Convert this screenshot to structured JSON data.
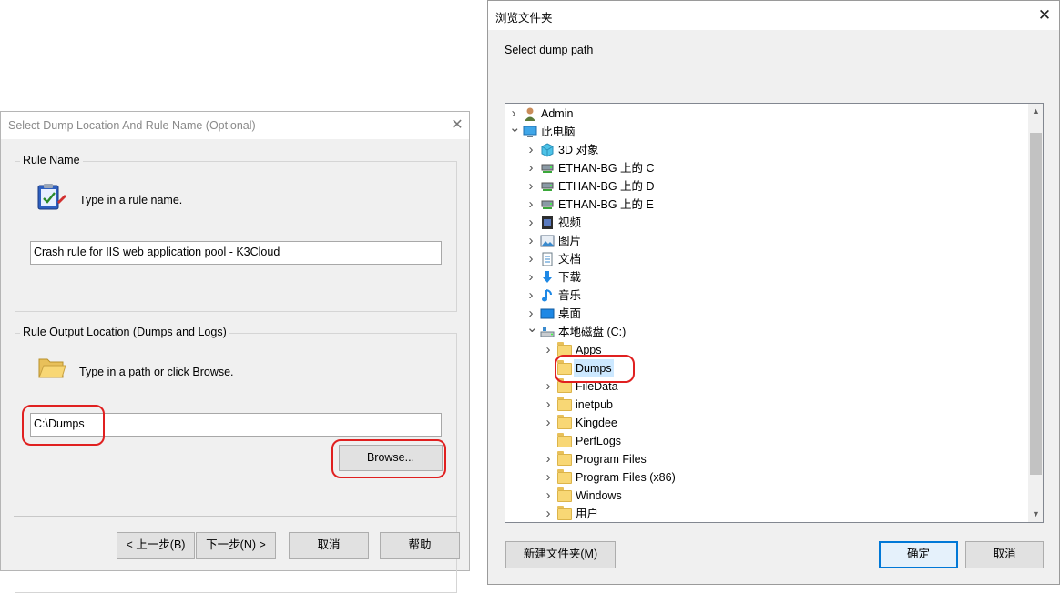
{
  "wizard": {
    "title": "Select Dump Location And Rule Name (Optional)",
    "rule_group_label": "Rule Name",
    "rule_prompt": "Type in a rule name.",
    "rule_name_value": "Crash rule for IIS web application pool - K3Cloud",
    "output_group_label": "Rule Output Location (Dumps and Logs)",
    "output_prompt": "Type in a path or click Browse.",
    "path_value": "C:\\Dumps",
    "browse_label": "Browse...",
    "back_label": "< 上一步(B)",
    "next_label": "下一步(N) >",
    "cancel_label": "取消",
    "help_label": "帮助"
  },
  "browser": {
    "title": "浏览文件夹",
    "prompt": "Select dump path",
    "tree": [
      {
        "label": "Admin",
        "icon": "user-icon",
        "expander": ">"
      },
      {
        "label": "此电脑",
        "icon": "computer-icon",
        "expander": "v"
      },
      {
        "label": "3D 对象",
        "icon": "3d-objects-icon",
        "expander": ">"
      },
      {
        "label": "ETHAN-BG 上的 C",
        "icon": "network-drive-icon",
        "expander": ">"
      },
      {
        "label": "ETHAN-BG 上的 D",
        "icon": "network-drive-icon",
        "expander": ">"
      },
      {
        "label": "ETHAN-BG 上的 E",
        "icon": "network-drive-icon",
        "expander": ">"
      },
      {
        "label": "视频",
        "icon": "videos-icon",
        "expander": ">"
      },
      {
        "label": "图片",
        "icon": "pictures-icon",
        "expander": ">"
      },
      {
        "label": "文档",
        "icon": "documents-icon",
        "expander": ">"
      },
      {
        "label": "下载",
        "icon": "downloads-icon",
        "expander": ">"
      },
      {
        "label": "音乐",
        "icon": "music-icon",
        "expander": ">"
      },
      {
        "label": "桌面",
        "icon": "desktop-icon",
        "expander": ">"
      },
      {
        "label": "本地磁盘 (C:)",
        "icon": "local-disk-icon",
        "expander": "v"
      },
      {
        "label": "Apps",
        "icon": "folder-icon",
        "expander": ">"
      },
      {
        "label": "Dumps",
        "icon": "folder-icon",
        "expander": "",
        "selected": true
      },
      {
        "label": "FileData",
        "icon": "folder-icon",
        "expander": ">"
      },
      {
        "label": "inetpub",
        "icon": "folder-icon",
        "expander": ">"
      },
      {
        "label": "Kingdee",
        "icon": "folder-icon",
        "expander": ">"
      },
      {
        "label": "PerfLogs",
        "icon": "folder-icon",
        "expander": ""
      },
      {
        "label": "Program Files",
        "icon": "folder-icon",
        "expander": ">"
      },
      {
        "label": "Program Files (x86)",
        "icon": "folder-icon",
        "expander": ">"
      },
      {
        "label": "Windows",
        "icon": "folder-icon",
        "expander": ">"
      },
      {
        "label": "用户",
        "icon": "folder-icon",
        "expander": ">"
      }
    ],
    "new_folder_label": "新建文件夹(M)",
    "ok_label": "确定",
    "cancel_label": "取消"
  },
  "colors": {
    "annotation": "#e02020",
    "selection": "#cce8ff",
    "default_button_border": "#0078d7"
  }
}
